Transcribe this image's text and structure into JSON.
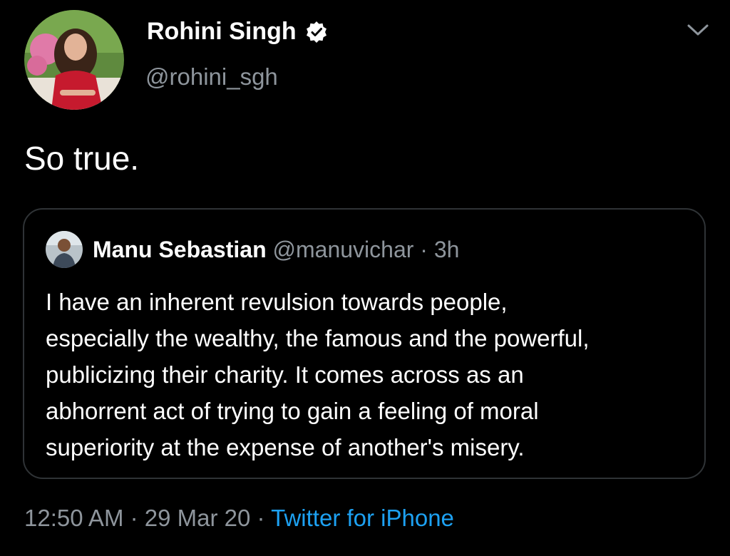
{
  "author": {
    "name": "Rohini Singh",
    "handle": "@rohini_sgh",
    "verified": true,
    "avatar_icon": "profile-photo"
  },
  "tweet": {
    "text": "So true."
  },
  "quoted": {
    "name": "Manu Sebastian",
    "handle": "@manuvichar",
    "separator": "·",
    "time": "3h",
    "lines": [
      "I have an inherent revulsion towards people,",
      "especially the wealthy, the famous and the powerful,",
      "publicizing their charity. It comes across as an",
      "abhorrent act of trying to gain a feeling of moral",
      "superiority at the expense of another's misery."
    ]
  },
  "meta": {
    "time": "12:50 AM",
    "sep1": "·",
    "date": "29 Mar 20",
    "sep2": "·",
    "source": "Twitter for iPhone"
  },
  "colors": {
    "background": "#000000",
    "text_primary": "#ffffff",
    "text_secondary": "#8e959c",
    "link": "#1da1f2",
    "border": "#2f3336"
  }
}
